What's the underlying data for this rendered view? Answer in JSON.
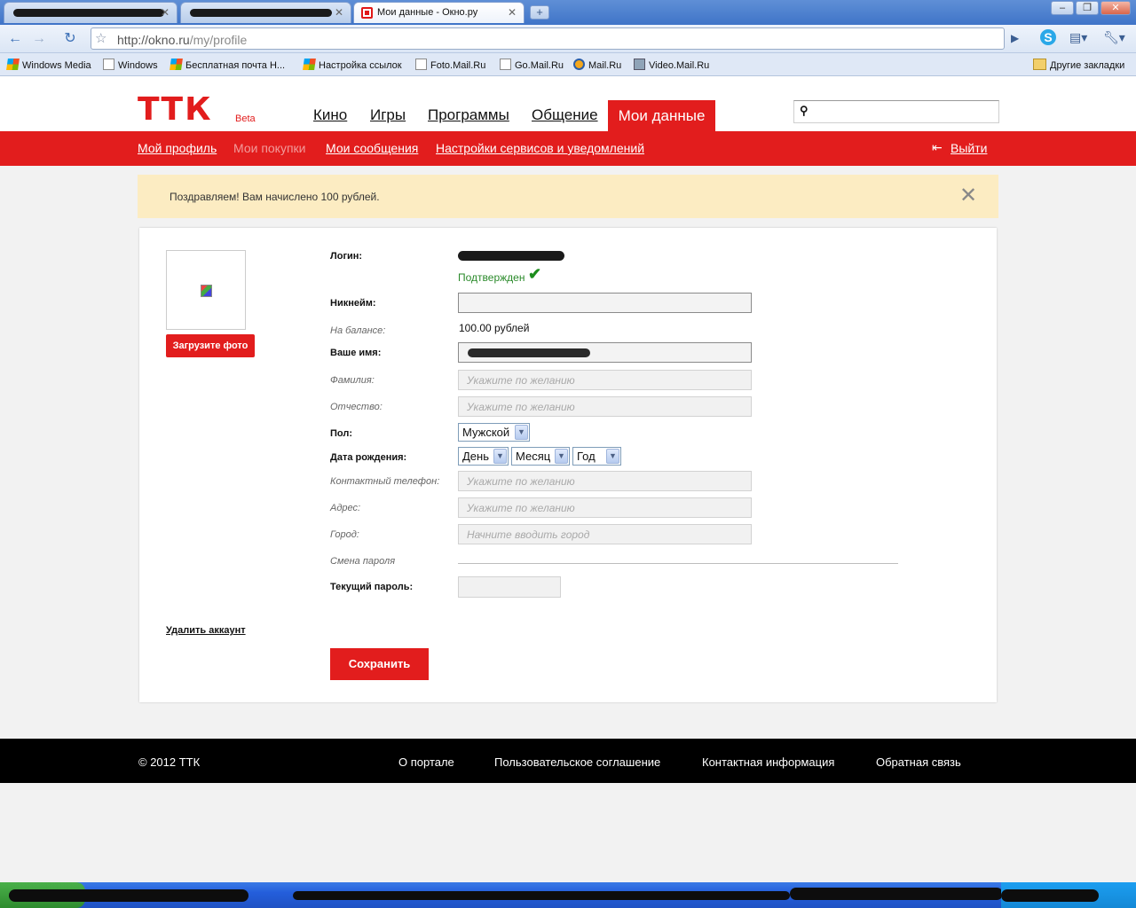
{
  "browser": {
    "tabs": [
      {
        "title": ""
      },
      {
        "title": ""
      },
      {
        "title": "Мои данные - Окно.ру"
      }
    ],
    "url_host": "http://okno.ru",
    "url_path": "/my/profile",
    "bookmarks": [
      {
        "label": "Windows Media",
        "icon": "windows-logo-icon"
      },
      {
        "label": "Windows",
        "icon": "page-icon"
      },
      {
        "label": "Бесплатная почта Н...",
        "icon": "windows-logo-icon"
      },
      {
        "label": "Настройка ссылок",
        "icon": "windows-logo-icon"
      },
      {
        "label": "Foto.Mail.Ru",
        "icon": "page-icon"
      },
      {
        "label": "Go.Mail.Ru",
        "icon": "page-icon"
      },
      {
        "label": "Mail.Ru",
        "icon": "mail-icon"
      },
      {
        "label": "Video.Mail.Ru",
        "icon": "video-icon"
      }
    ],
    "other_bookmarks": "Другие закладки"
  },
  "site": {
    "logo": "ТТК",
    "beta": "Beta",
    "nav": [
      "Кино",
      "Игры",
      "Программы",
      "Общение"
    ],
    "nav_active": "Мои данные",
    "subnav": {
      "profile": "Мой профиль",
      "purchases": "Мои покупки",
      "messages": "Мои сообщения",
      "settings": "Настройки сервисов и уведомлений",
      "logout": "Выйти"
    },
    "notice": "Поздравляем! Вам начислено 100 рублей.",
    "close_glyph": "✕"
  },
  "profile": {
    "upload_photo": "Загрузите фото",
    "delete_account": "Удалить аккаунт",
    "labels": {
      "login": "Логин:",
      "nickname": "Никнейм:",
      "balance": "На балансе:",
      "name": "Ваше имя:",
      "surname": "Фамилия:",
      "patronymic": "Отчество:",
      "gender": "Пол:",
      "birthdate": "Дата рождения:",
      "phone": "Контактный телефон:",
      "address": "Адрес:",
      "city": "Город:",
      "password_change": "Смена пароля",
      "current_password": "Текущий пароль:"
    },
    "verified": "Подтвержден",
    "balance_value": "100.00 рублей",
    "placeholders": {
      "optional": "Укажите по желанию",
      "city": "Начните вводить город"
    },
    "gender_value": "Мужской",
    "day": "День",
    "month": "Месяц",
    "year": "Год",
    "save": "Сохранить"
  },
  "footer": {
    "copyright": "© 2012 ТТК",
    "links": [
      "О портале",
      "Пользовательское соглашение",
      "Контактная информация",
      "Обратная связь"
    ]
  },
  "colors": {
    "brand_red": "#e21d1d",
    "notice_bg": "#fcecc2",
    "verified_green": "#2a8a2a"
  }
}
